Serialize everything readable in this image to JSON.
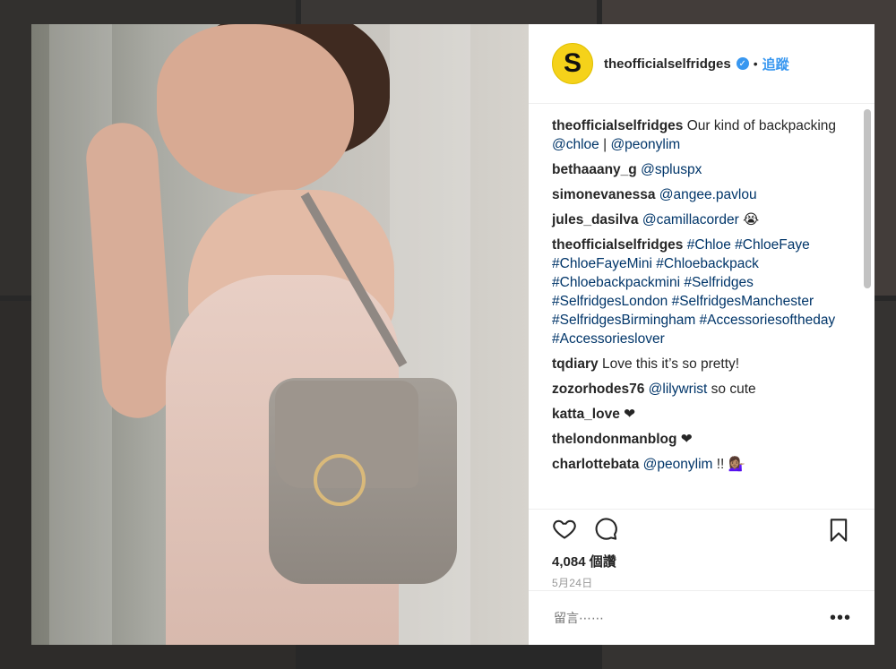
{
  "post": {
    "avatar_letter": "S",
    "username": "theofficialselfridges",
    "verified_icon": "verified-check-icon",
    "separator": "•",
    "follow_label": "追蹤",
    "comments": [
      {
        "user": "theofficialselfridges",
        "parts": [
          {
            "t": "Our kind of backpacking "
          },
          {
            "t": "@chloe",
            "tag": true
          },
          {
            "t": " | "
          },
          {
            "t": "@peonylim",
            "tag": true
          }
        ]
      },
      {
        "user": "bethaaany_g",
        "parts": [
          {
            "t": "@spluspx",
            "tag": true
          }
        ]
      },
      {
        "user": "simonevanessa",
        "parts": [
          {
            "t": "@angee.pavlou",
            "tag": true
          }
        ]
      },
      {
        "user": "jules_dasilva",
        "parts": [
          {
            "t": "@camillacorder",
            "tag": true
          },
          {
            "t": " 😭"
          }
        ]
      },
      {
        "user": "theofficialselfridges",
        "parts": [
          {
            "t": "#Chloe #ChloeFaye #ChloeFayeMini #Chloebackpack #Chloebackpackmini #Selfridges #SelfridgesLondon #SelfridgesManchester #SelfridgesBirmingham #Accessoriesoftheday #Accessorieslover",
            "tag": true
          }
        ]
      },
      {
        "user": "tqdiary",
        "parts": [
          {
            "t": "Love this it’s so pretty!"
          }
        ]
      },
      {
        "user": "zozorhodes76",
        "parts": [
          {
            "t": "@lilywrist",
            "tag": true
          },
          {
            "t": " so cute"
          }
        ]
      },
      {
        "user": "katta_love",
        "parts": [
          {
            "t": "❤"
          }
        ]
      },
      {
        "user": "thelondonmanblog",
        "parts": [
          {
            "t": "❤"
          }
        ]
      },
      {
        "user": "charlottebata",
        "parts": [
          {
            "t": "@peonylim",
            "tag": true
          },
          {
            "t": " !! 💁🏽‍♀️"
          }
        ]
      }
    ],
    "likes": "4,084 個讚",
    "date": "5月24日",
    "comment_placeholder": "留言⋯⋯",
    "more_label": "•••"
  },
  "colors": {
    "link_blue": "#3897f0",
    "tag_blue": "#003569",
    "avatar_yellow": "#f5d21a"
  }
}
